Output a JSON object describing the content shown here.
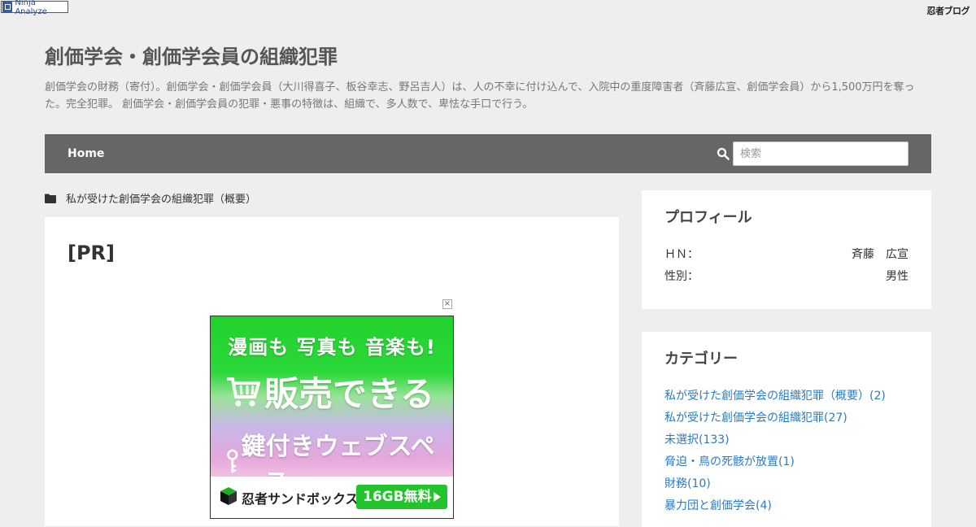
{
  "top_bar": {
    "ninja_badge": "Ninja Analyze",
    "ninja_logo": "忍者ブログ"
  },
  "header": {
    "title": "創価学会・創価学会員の組織犯罪",
    "description": "創価学会の財務（寄付）。創価学会・創価学会員（大川得喜子、板谷幸志、野呂吉人）は、人の不幸に付け込んで、入院中の重度障害者（斉藤広宣、創価学会員）から1,500万円を奪った。完全犯罪。 創価学会・創価学会員の犯罪・悪事の特徴は、組織で、多人数で、卑怯な手口で行う。"
  },
  "nav": {
    "home_label": "Home",
    "search_placeholder": "検索",
    "search_value": ""
  },
  "breadcrumb": {
    "category": "私が受けた創価学会の組織犯罪（概要）"
  },
  "main": {
    "pr_title": "[PR]",
    "ad": {
      "close_label": "×",
      "line1": "漫画も 写真も 音楽も!",
      "line2": "販売できる",
      "line3": "鍵付きウェブスペース",
      "brand": "忍者サンドボックス",
      "cta": "16GB無料"
    }
  },
  "sidebar": {
    "profile": {
      "title": "プロフィール",
      "rows": [
        {
          "label": "ＨＮ：",
          "value": "斉藤　広宣"
        },
        {
          "label": "性別：",
          "value": "男性"
        }
      ]
    },
    "categories": {
      "title": "カテゴリー",
      "items": [
        {
          "label": "私が受けた創価学会の組織犯罪（概要）(2)"
        },
        {
          "label": "私が受けた創価学会の組織犯罪(27)"
        },
        {
          "label": "未選択(133)"
        },
        {
          "label": "脅迫・鳥の死骸が放置(1)"
        },
        {
          "label": "財務(10)"
        },
        {
          "label": "暴力団と創価学会(4)"
        }
      ]
    }
  },
  "colors": {
    "nav_bg": "#666666",
    "page_bg": "#eeeeee",
    "link": "#2a7bc6",
    "ad_green": "#22c42b"
  }
}
